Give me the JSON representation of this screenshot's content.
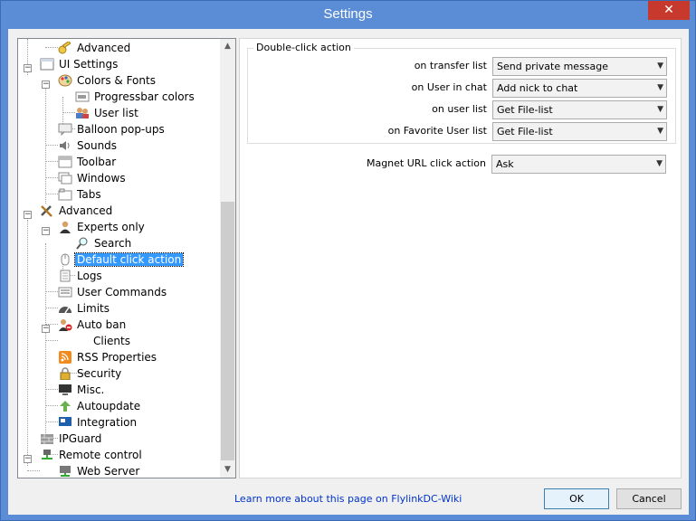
{
  "window": {
    "title": "Settings",
    "close_glyph": "✕"
  },
  "tree": {
    "items": [
      {
        "label": "Advanced",
        "icon": "key-icon"
      },
      {
        "label": "UI Settings",
        "icon": "window-icon"
      },
      {
        "label": "Colors & Fonts",
        "icon": "palette-icon"
      },
      {
        "label": "Progressbar colors",
        "icon": "progress-icon"
      },
      {
        "label": "User list",
        "icon": "users-icon"
      },
      {
        "label": "Balloon pop-ups",
        "icon": "balloon-icon"
      },
      {
        "label": "Sounds",
        "icon": "speaker-icon"
      },
      {
        "label": "Toolbar",
        "icon": "toolbar-icon"
      },
      {
        "label": "Windows",
        "icon": "windows-icon"
      },
      {
        "label": "Tabs",
        "icon": "tabs-icon"
      },
      {
        "label": "Advanced",
        "icon": "tools-icon"
      },
      {
        "label": "Experts only",
        "icon": "user-icon"
      },
      {
        "label": "Search",
        "icon": "magnifier-icon"
      },
      {
        "label": "Default click action",
        "icon": "mouse-icon"
      },
      {
        "label": "Logs",
        "icon": "document-icon"
      },
      {
        "label": "User Commands",
        "icon": "commands-icon"
      },
      {
        "label": "Limits",
        "icon": "gauge-icon"
      },
      {
        "label": "Auto ban",
        "icon": "ban-user-icon"
      },
      {
        "label": "Clients",
        "icon": ""
      },
      {
        "label": "RSS Properties",
        "icon": "rss-icon"
      },
      {
        "label": "Security",
        "icon": "lock-icon"
      },
      {
        "label": "Misc.",
        "icon": "monitor-icon"
      },
      {
        "label": "Autoupdate",
        "icon": "update-icon"
      },
      {
        "label": "Integration",
        "icon": "integration-icon"
      },
      {
        "label": "IPGuard",
        "icon": "wall-icon"
      },
      {
        "label": "Remote control",
        "icon": "network-icon"
      },
      {
        "label": "Web Server",
        "icon": "server-icon"
      }
    ]
  },
  "panel": {
    "group_title": "Double-click action",
    "rows": [
      {
        "label": "on transfer list",
        "value": "Send private message"
      },
      {
        "label": "on User in chat",
        "value": "Add nick to chat"
      },
      {
        "label": "on user list",
        "value": "Get File-list"
      },
      {
        "label": "on Favorite User list",
        "value": "Get File-list"
      }
    ],
    "magnet": {
      "label": "Magnet URL click action",
      "value": "Ask"
    }
  },
  "footer": {
    "help_link": "Learn more about this page on FlylinkDC-Wiki",
    "ok": "OK",
    "cancel": "Cancel"
  }
}
